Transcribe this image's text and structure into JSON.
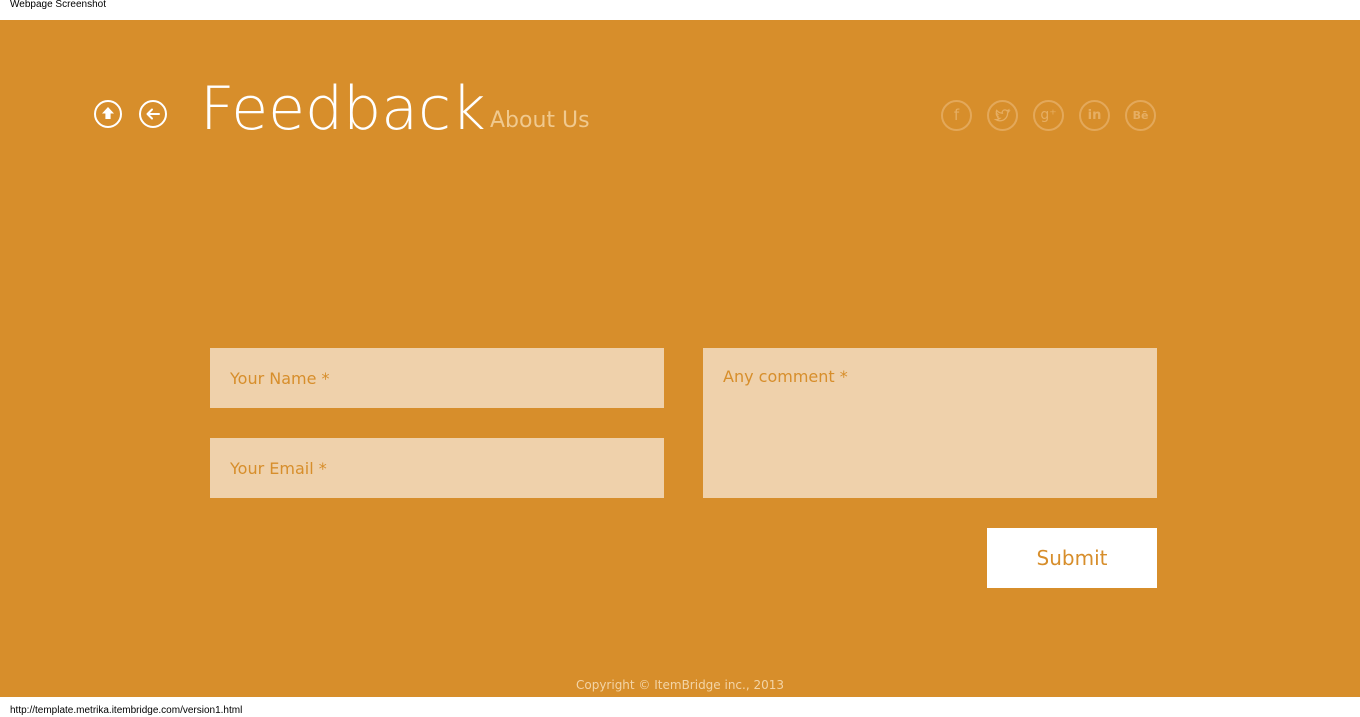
{
  "screenshot_label": "Webpage Screenshot",
  "header": {
    "title": "Feedback",
    "about_link": "About Us",
    "nav_icons": [
      "home-up-arrow-icon",
      "back-arrow-icon"
    ],
    "social_icons": {
      "facebook": "f",
      "twitter": "twitter-bird-icon",
      "google_plus": "g⁺",
      "linkedin": "in",
      "behance": "Bē"
    }
  },
  "form": {
    "name_placeholder": "Your Name *",
    "email_placeholder": "Your Email *",
    "comment_placeholder": "Any comment *",
    "submit_label": "Submit"
  },
  "footer": {
    "copyright": "Copyright © ItemBridge inc., 2013"
  },
  "status_bar": {
    "url": "http://template.metrika.itembridge.com/version1.html"
  },
  "colors": {
    "background": "#d78e2b",
    "field_background": "#efd1ab",
    "accent_text": "#d78e2b",
    "button_background": "#ffffff"
  }
}
